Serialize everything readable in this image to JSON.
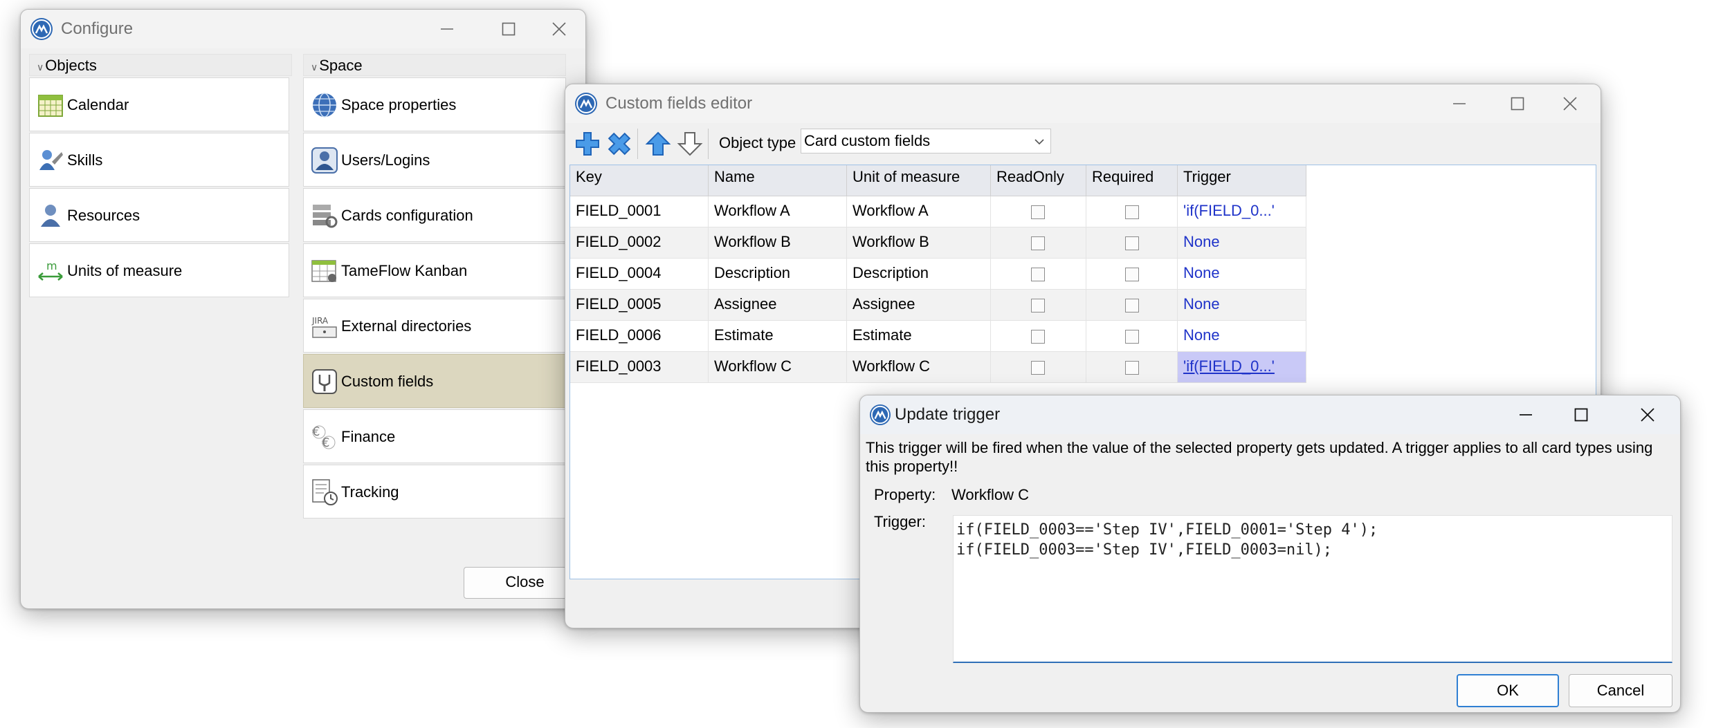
{
  "configure": {
    "title": "Configure",
    "objects_header": "Objects",
    "space_header": "Space",
    "objects_items": [
      {
        "label": "Calendar",
        "icon": "calendar-icon"
      },
      {
        "label": "Skills",
        "icon": "skills-icon"
      },
      {
        "label": "Resources",
        "icon": "resources-icon"
      },
      {
        "label": "Units of measure",
        "icon": "units-of-measure-icon"
      }
    ],
    "space_items": [
      {
        "label": "Space properties",
        "icon": "globe-icon"
      },
      {
        "label": "Users/Logins",
        "icon": "user-login-icon"
      },
      {
        "label": "Cards configuration",
        "icon": "cards-config-icon"
      },
      {
        "label": "TameFlow Kanban",
        "icon": "kanban-icon"
      },
      {
        "label": "External directories",
        "icon": "jira-icon"
      },
      {
        "label": "Custom fields",
        "icon": "custom-fields-icon",
        "selected": true
      },
      {
        "label": "Finance",
        "icon": "finance-icon"
      },
      {
        "label": "Tracking",
        "icon": "tracking-icon"
      }
    ],
    "close_label": "Close"
  },
  "cfe": {
    "title": "Custom fields editor",
    "object_type_label": "Object type",
    "object_type_value": "Card custom fields",
    "columns": [
      "Key",
      "Name",
      "Unit of measure",
      "ReadOnly",
      "Required",
      "Trigger"
    ],
    "rows": [
      {
        "key": "FIELD_0001",
        "name": "Workflow A",
        "unit": "Workflow A",
        "readonly": false,
        "required": false,
        "trigger": "'if(FIELD_0...'"
      },
      {
        "key": "FIELD_0002",
        "name": "Workflow B",
        "unit": "Workflow B",
        "readonly": false,
        "required": false,
        "trigger": "None"
      },
      {
        "key": "FIELD_0004",
        "name": "Description",
        "unit": "Description",
        "readonly": false,
        "required": false,
        "trigger": "None"
      },
      {
        "key": "FIELD_0005",
        "name": "Assignee",
        "unit": "Assignee",
        "readonly": false,
        "required": false,
        "trigger": "None"
      },
      {
        "key": "FIELD_0006",
        "name": "Estimate",
        "unit": "Estimate",
        "readonly": false,
        "required": false,
        "trigger": "None"
      },
      {
        "key": "FIELD_0003",
        "name": "Workflow C",
        "unit": "Workflow C",
        "readonly": false,
        "required": false,
        "trigger": "'if(FIELD_0...'",
        "selected": true
      }
    ]
  },
  "ut": {
    "title": "Update trigger",
    "message": "This trigger will be fired when the value of the selected property gets updated. A trigger applies to all card types using this property!!",
    "property_label": "Property:",
    "property_value": "Workflow C",
    "trigger_label": "Trigger:",
    "trigger_text": "if(FIELD_0003=='Step IV',FIELD_0001='Step 4');\nif(FIELD_0003=='Step IV',FIELD_0003=nil);",
    "ok_label": "OK",
    "cancel_label": "Cancel"
  },
  "colors": {
    "accent": "#2f7fd3",
    "link": "#1f33c9",
    "selection": "#dcd7bf",
    "grid_selection": "#c9c9f7"
  }
}
